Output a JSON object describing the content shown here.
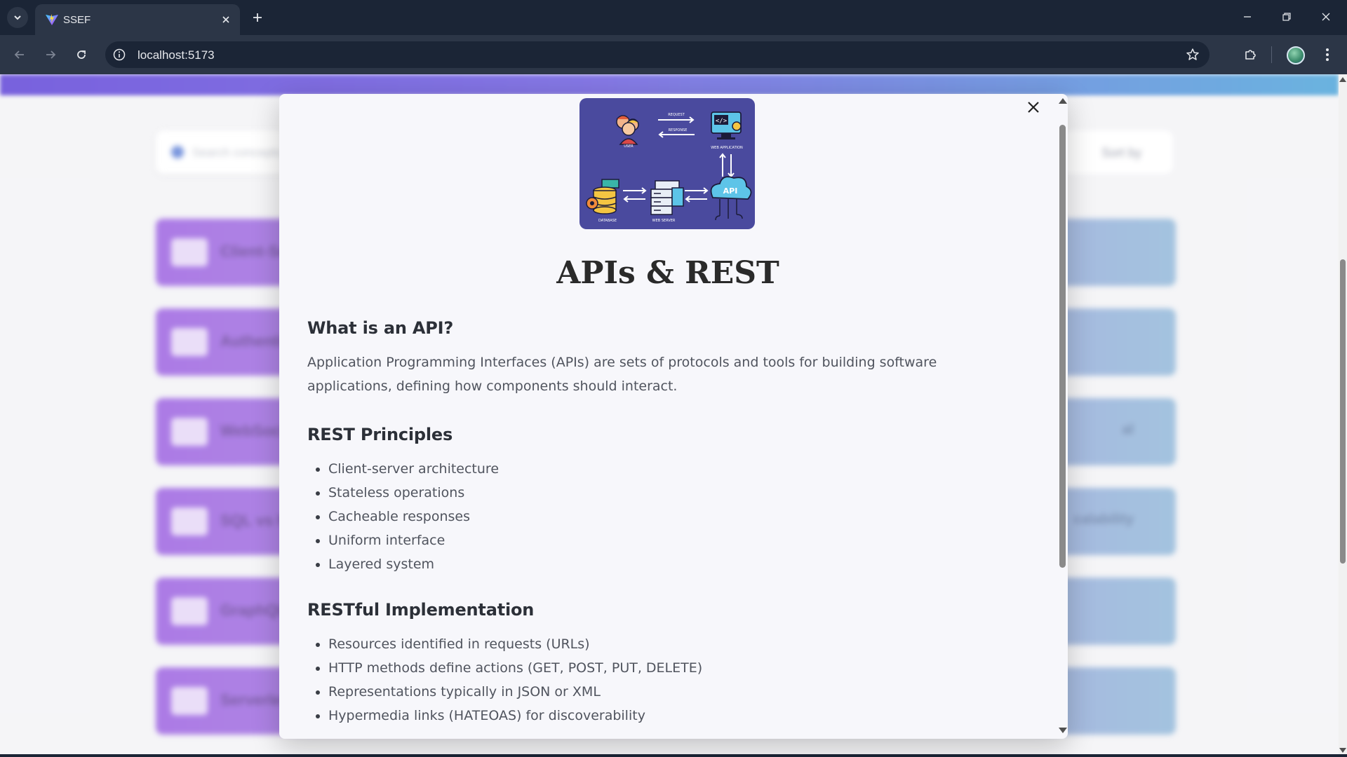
{
  "browser": {
    "tab_title": "SSEF",
    "url": "localhost:5173"
  },
  "page": {
    "search_placeholder": "Search concepts...",
    "sort_label": "Sort by",
    "cards": [
      {
        "title": "Client-Server Model",
        "right": ""
      },
      {
        "title": "Authentication",
        "right": ""
      },
      {
        "title": "WebSockets",
        "right": "al"
      },
      {
        "title": "SQL vs NoSQL",
        "right": "calability"
      },
      {
        "title": "GraphQL",
        "right": ""
      },
      {
        "title": "Serverless",
        "right": ""
      }
    ]
  },
  "modal": {
    "image_labels": {
      "user": "USER",
      "request": "REQUEST",
      "response": "RESPONSE",
      "web_application": "WEB APPLICATION",
      "database": "DATABASE",
      "web_server": "WEB SERVER",
      "api": "API"
    },
    "title": "APIs & REST",
    "sections": [
      {
        "heading": "What is an API?",
        "paragraph": "Application Programming Interfaces (APIs) are sets of protocols and tools for building software applications, defining how components should interact."
      },
      {
        "heading": "REST Principles",
        "items": [
          "Client-server architecture",
          "Stateless operations",
          "Cacheable responses",
          "Uniform interface",
          "Layered system"
        ]
      },
      {
        "heading": "RESTful Implementation",
        "items": [
          "Resources identified in requests (URLs)",
          "HTTP methods define actions (GET, POST, PUT, DELETE)",
          "Representations typically in JSON or XML",
          "Hypermedia links (HATEOAS) for discoverability"
        ]
      }
    ]
  },
  "colors": {
    "chrome_dark": "#1b2536",
    "chrome_mid": "#2c3647",
    "modal_bg": "#f7f7fb",
    "card_gradient_start": "#9a5ee0",
    "card_gradient_end": "#8fb6d8"
  }
}
